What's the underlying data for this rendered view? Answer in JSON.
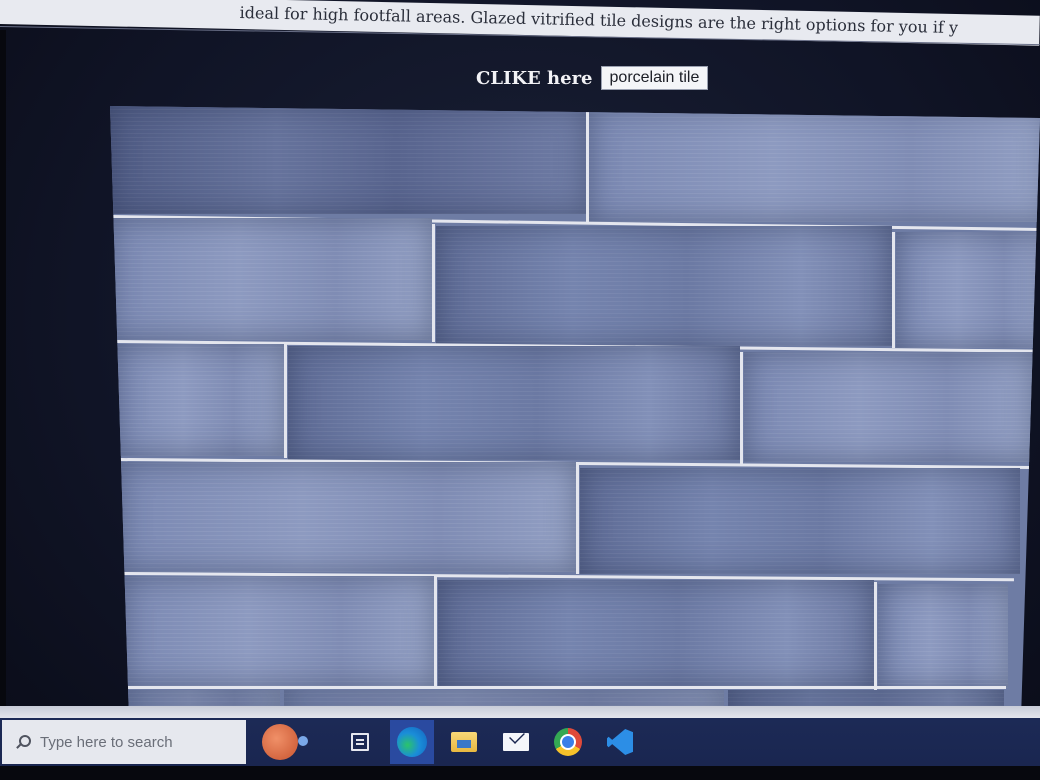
{
  "page": {
    "top_text": "ideal for high footfall areas. Glazed vitrified tile designs are the right options for you if y",
    "clike_label": "CLIKE here",
    "tile_button_label": "porcelain tile"
  },
  "taskbar": {
    "search_placeholder": "Type here to search",
    "icons": [
      "cortana-icon",
      "task-view-icon",
      "edge-icon",
      "file-explorer-icon",
      "mail-icon",
      "chrome-icon",
      "vscode-icon"
    ]
  },
  "colors": {
    "tile_blue": "#6e7ca4",
    "grout": "#e4e6ee",
    "taskbar": "#1a2650"
  }
}
